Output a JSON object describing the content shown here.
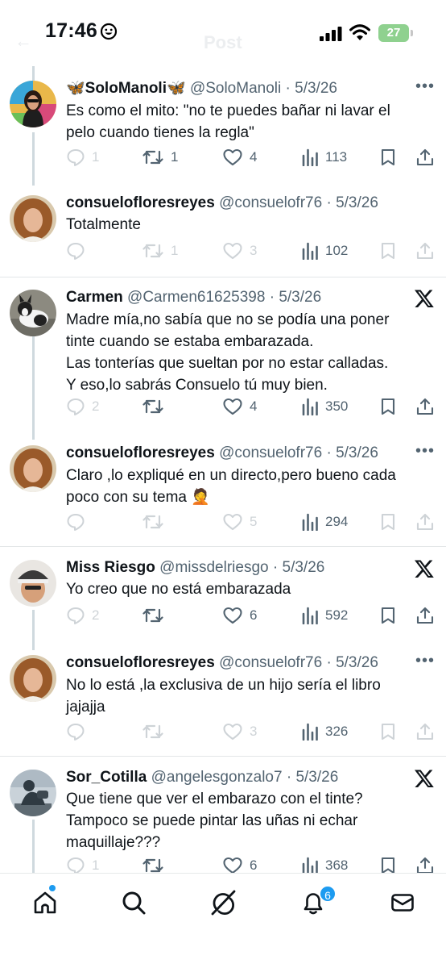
{
  "status_bar": {
    "time": "17:46",
    "battery": "27"
  },
  "header": {
    "back_label": "←",
    "title": "Post"
  },
  "tweets": [
    {
      "name": "🦋SoloManoli🦋",
      "handle": "@SoloManoli",
      "date": "· 5/3/26",
      "text": "Es como el mito: \"no te puedes bañar ni lavar el pelo cuando tienes la regla\"",
      "replies": "1",
      "retweets": "1",
      "likes": "4",
      "views": "113"
    },
    {
      "name": "consuelofloresreyes",
      "handle": "@consuelofr76",
      "date": "· 5/3/26",
      "text": "Totalmente",
      "replies": "",
      "retweets": "1",
      "likes": "3",
      "views": "102"
    },
    {
      "name": "Carmen",
      "handle": "@Carmen61625398",
      "date": "· 5/3/26",
      "text": "Madre mía,no sabía que no se podía una poner tinte cuando se estaba embarazada.\nLas tonterías que sueltan por no estar calladas.\n Y  eso,lo sabrás Consuelo tú muy bien.",
      "replies": "2",
      "retweets": "",
      "likes": "4",
      "views": "350"
    },
    {
      "name": "consuelofloresreyes",
      "handle": "@consuelofr76",
      "date": "· 5/3/26",
      "text": "Claro ,lo expliqué en un directo,pero bueno cada poco con su tema 🤦",
      "replies": "",
      "retweets": "",
      "likes": "5",
      "views": "294"
    },
    {
      "name": "Miss Riesgo",
      "handle": "@missdelriesgo",
      "date": "· 5/3/26",
      "text": "Yo creo que no está embarazada",
      "replies": "2",
      "retweets": "",
      "likes": "6",
      "views": "592"
    },
    {
      "name": "consuelofloresreyes",
      "handle": "@consuelofr76",
      "date": "· 5/3/26",
      "text": "No lo está ,la exclusiva de un hijo sería el libro jajajja",
      "replies": "",
      "retweets": "",
      "likes": "3",
      "views": "326"
    },
    {
      "name": "Sor_Cotilla",
      "handle": "@angelesgonzalo7",
      "date": "· 5/3/26",
      "text": "Que tiene que ver el embarazo con el tinte?\nTampoco se puede pintar las uñas ni echar maquillaje???",
      "replies": "1",
      "retweets": "",
      "likes": "6",
      "views": "368"
    }
  ],
  "bottom_nav": {
    "notifications_badge": "6"
  },
  "icons": [
    "home-icon",
    "search-icon",
    "grok-icon",
    "bell-icon",
    "mail-icon",
    "x-logo-icon",
    "more-icon",
    "reply-icon",
    "retweet-icon",
    "like-icon",
    "views-icon",
    "bookmark-icon",
    "share-icon"
  ],
  "colors": {
    "accent": "#1d9bf0",
    "text": "#0f1419",
    "secondary": "#536471",
    "battery": "#8fd18f"
  }
}
